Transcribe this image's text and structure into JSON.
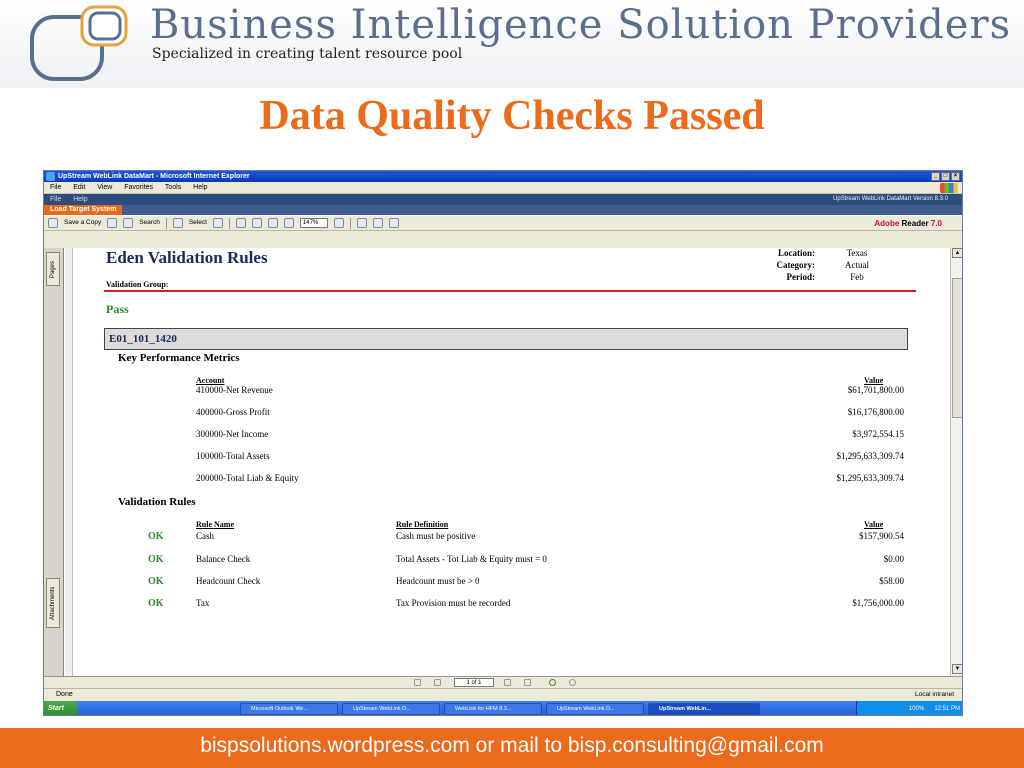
{
  "slide": {
    "company_name": "Business Intelligence Solution Providers",
    "tagline": "Specialized in creating talent resource pool",
    "heading": "Data Quality Checks Passed",
    "footer": "bispsolutions.wordpress.com or mail to bisp.consulting@gmail.com",
    "colors": {
      "heading": "#ec6a1c",
      "footer_bg": "#ec6a1c",
      "company": "#5a6f8e"
    }
  },
  "browser": {
    "title": "UpStream WebLink DataMart - Microsoft Internet Explorer",
    "menu": [
      "File",
      "Edit",
      "View",
      "Favorites",
      "Tools",
      "Help"
    ],
    "status": "Done",
    "zone": "Local intranet"
  },
  "app": {
    "menu": [
      "File",
      "Help"
    ],
    "version": "UpStream WebLink DataMart Version 8.3.0",
    "tab": "Load Target System"
  },
  "pdf_toolbar": {
    "save_copy": "Save a Copy",
    "search": "Search",
    "select": "Select",
    "zoom": "147%",
    "brand_adobe": "Adobe",
    "brand_reader": "Reader",
    "brand_version": "7.0"
  },
  "pdf_sidebar": {
    "pages_tab": "Pages",
    "attachments_tab": "Attachments"
  },
  "report": {
    "title": "Eden Validation Rules",
    "validation_group_label": "Validation Group:",
    "location_label": "Location:",
    "location": "Texas",
    "category_label": "Category:",
    "category": "Actual",
    "period_label": "Period:",
    "period": "Feb",
    "status": "Pass",
    "entity_code": "E01_101_1420",
    "kpi_section": "Key Performance Metrics",
    "kpi_headers": {
      "account": "Account",
      "value": "Value"
    },
    "kpis": [
      {
        "account": "410000-Net Revenue",
        "value": "$61,701,800.00"
      },
      {
        "account": "400000-Gross Profit",
        "value": "$16,176,800.00"
      },
      {
        "account": "300000-Net Income",
        "value": "$3,972,554.15"
      },
      {
        "account": "100000-Total Assets",
        "value": "$1,295,633,309.74"
      },
      {
        "account": "200000-Total Liab & Equity",
        "value": "$1,295,633,309.74"
      }
    ],
    "rules_section": "Validation Rules",
    "rule_headers": {
      "name": "Rule Name",
      "definition": "Rule Definition",
      "value": "Value"
    },
    "rules": [
      {
        "status": "OK",
        "name": "Cash",
        "definition": "Cash must be positive",
        "value": "$157,900.54"
      },
      {
        "status": "OK",
        "name": "Balance Check",
        "definition": "Total Assets - Tot Liab & Equity must = 0",
        "value": "$0.00"
      },
      {
        "status": "OK",
        "name": "Headcount Check",
        "definition": "Headcount must be > 0",
        "value": "$58.00"
      },
      {
        "status": "OK",
        "name": "Tax",
        "definition": "Tax Provision must be recorded",
        "value": "$1,756,000.00"
      }
    ]
  },
  "pdf_nav": {
    "page_indicator": "1 of 1"
  },
  "taskbar": {
    "start": "Start",
    "tasks": [
      "Microsoft Outlook We...",
      "UpStream WebLink D...",
      "WebLink for HFM 8.3...",
      "UpStream WebLink D...",
      "UpStream WebLin..."
    ],
    "battery": "100%",
    "clock": "12:51 PM"
  }
}
